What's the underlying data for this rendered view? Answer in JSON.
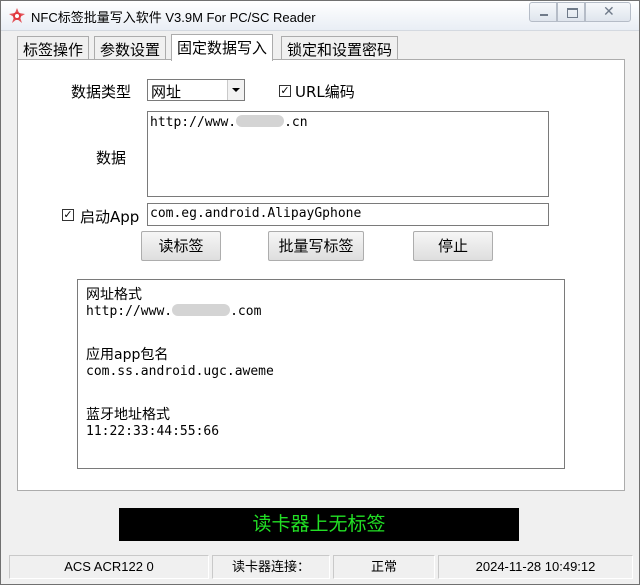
{
  "window": {
    "title": "NFC标签批量写入软件 V3.9M For PC/SC Reader",
    "controls": [
      "minimize",
      "maximize",
      "close"
    ]
  },
  "tabs": [
    {
      "label": "标签操作",
      "active": false
    },
    {
      "label": "参数设置",
      "active": false
    },
    {
      "label": "固定数据写入",
      "active": true
    },
    {
      "label": "锁定和设置密码",
      "active": false
    }
  ],
  "form": {
    "data_type_label": "数据类型",
    "data_type_value": "网址",
    "url_encode_label": "URL编码",
    "url_encode_checked": true,
    "data_label": "数据",
    "data_value_prefix": "http://www.",
    "data_value_suffix": ".cn",
    "launch_app_label": "启动App",
    "launch_app_checked": true,
    "app_package": "com.eg.android.AlipayGphone"
  },
  "buttons": {
    "read_tag": "读标签",
    "batch_write": "批量写标签",
    "stop": "停止"
  },
  "info": {
    "url_format_title": "网址格式",
    "url_format_example_prefix": "http://www.",
    "url_format_example_suffix": ".com",
    "app_package_title": "应用app包名",
    "app_package_example": "com.ss.android.ugc.aweme",
    "bt_format_title": "蓝牙地址格式",
    "bt_format_example": "11:22:33:44:55:66"
  },
  "status_display": "读卡器上无标签",
  "statusbar": {
    "reader_name": "ACS ACR122 0",
    "connection_label": "读卡器连接：",
    "connection_status": "正常",
    "datetime": "2024-11-28 10:49:12"
  },
  "colors": {
    "status_text": "#22e025",
    "status_bg": "#000000",
    "icon_red": "#e0383e"
  }
}
